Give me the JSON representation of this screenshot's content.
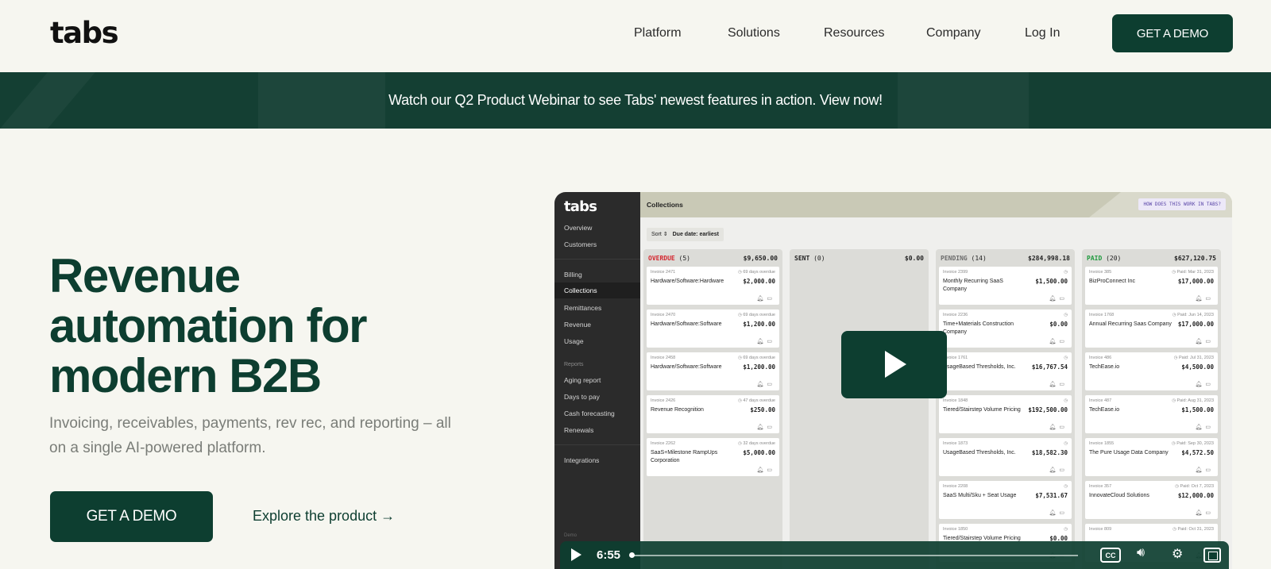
{
  "nav": {
    "logo": "tabs",
    "links": [
      "Platform",
      "Solutions",
      "Resources",
      "Company",
      "Log In"
    ],
    "cta": "GET A DEMO"
  },
  "banner": {
    "text": "Watch our Q2 Product Webinar to see Tabs' newest features in action. View now!"
  },
  "hero": {
    "title": "Revenue automation for modern B2B",
    "subtitle": "Invoicing, receivables, payments, rev rec, and reporting – all on a single AI-powered platform.",
    "cta": "GET A DEMO",
    "link": "Explore the product →"
  },
  "video": {
    "app_logo": "tabs",
    "sidebar": {
      "top": [
        "Overview",
        "Customers"
      ],
      "main": [
        "Billing",
        "Collections",
        "Remittances",
        "Revenue",
        "Usage"
      ],
      "reports_heading": "Reports",
      "reports": [
        "Aging report",
        "Days to pay",
        "Cash forecasting",
        "Renewals"
      ],
      "bottom": [
        "Integrations"
      ],
      "demo": "Demo"
    },
    "header_title": "Collections",
    "how_badge": "HOW DOES THIS WORK IN TABS?",
    "sort_label": "Sort",
    "sort_value": "Due date: earliest",
    "columns": [
      {
        "title": "OVERDUE",
        "count": "(5)",
        "total": "$9,650.00",
        "color": "#d4262e",
        "cards": [
          {
            "invoice": "Invoice 2471",
            "status": "69 days overdue",
            "name": "Hardware/Software:Hardware",
            "amount": "$2,000.00"
          },
          {
            "invoice": "Invoice 2470",
            "status": "69 days overdue",
            "name": "Hardware/Software:Software",
            "amount": "$1,200.00"
          },
          {
            "invoice": "Invoice 2458",
            "status": "69 days overdue",
            "name": "Hardware/Software:Software",
            "amount": "$1,200.00"
          },
          {
            "invoice": "Invoice 2426",
            "status": "47 days overdue",
            "name": "Revenue Recognition",
            "amount": "$250.00"
          },
          {
            "invoice": "Invoice 2262",
            "status": "32 days overdue",
            "name": "SaaS+Milestone RampUps Corporation",
            "amount": "$5,000.00"
          }
        ]
      },
      {
        "title": "SENT",
        "count": "(0)",
        "total": "$0.00",
        "color": "#222222",
        "cards": []
      },
      {
        "title": "PENDING",
        "count": "(14)",
        "total": "$284,998.18",
        "color": "#6b6b6b",
        "cards": [
          {
            "invoice": "Invoice 2399",
            "status": "",
            "name": "Monthly Recurring SaaS Company",
            "amount": "$1,500.00"
          },
          {
            "invoice": "Invoice 2236",
            "status": "",
            "name": "Time+Materials Construction Company",
            "amount": "$0.00"
          },
          {
            "invoice": "Invoice 1761",
            "status": "",
            "name": "UsageBased Thresholds, Inc.",
            "amount": "$16,767.54"
          },
          {
            "invoice": "Invoice 1848",
            "status": "",
            "name": "Tiered/Stairstep Volume Pricing",
            "amount": "$192,500.00"
          },
          {
            "invoice": "Invoice 1873",
            "status": "",
            "name": "UsageBased Thresholds, Inc.",
            "amount": "$18,582.30"
          },
          {
            "invoice": "Invoice 2208",
            "status": "",
            "name": "SaaS Multi/Sku + Seat Usage",
            "amount": "$7,531.67"
          },
          {
            "invoice": "Invoice 1850",
            "status": "",
            "name": "Tiered/Stairstep Volume Pricing",
            "amount": "$0.00"
          }
        ]
      },
      {
        "title": "PAID",
        "count": "(20)",
        "total": "$627,120.75",
        "color": "#1f9a3e",
        "cards": [
          {
            "invoice": "Invoice 385",
            "status": "Paid: Mar 31, 2023",
            "name": "BizProConnect Inc",
            "amount": "$17,000.00"
          },
          {
            "invoice": "Invoice 1768",
            "status": "Paid: Jun 14, 2023",
            "name": "Annual Recurring Saas Company",
            "amount": "$17,000.00"
          },
          {
            "invoice": "Invoice 486",
            "status": "Paid: Jul 31, 2023",
            "name": "TechEase.io",
            "amount": "$4,500.00"
          },
          {
            "invoice": "Invoice 487",
            "status": "Paid: Aug 31, 2023",
            "name": "TechEase.io",
            "amount": "$1,500.00"
          },
          {
            "invoice": "Invoice 1855",
            "status": "Paid: Sep 30, 2023",
            "name": "The Pure Usage Data Company",
            "amount": "$4,572.50"
          },
          {
            "invoice": "Invoice 357",
            "status": "Paid: Oct 7, 2023",
            "name": "InnovateCloud Solutions",
            "amount": "$12,000.00"
          },
          {
            "invoice": "Invoice 809",
            "status": "Paid: Oct 31, 2023",
            "name": "",
            "amount": ""
          }
        ]
      }
    ],
    "controls": {
      "time": "6:55",
      "cc": "CC",
      "progress": 0
    }
  }
}
